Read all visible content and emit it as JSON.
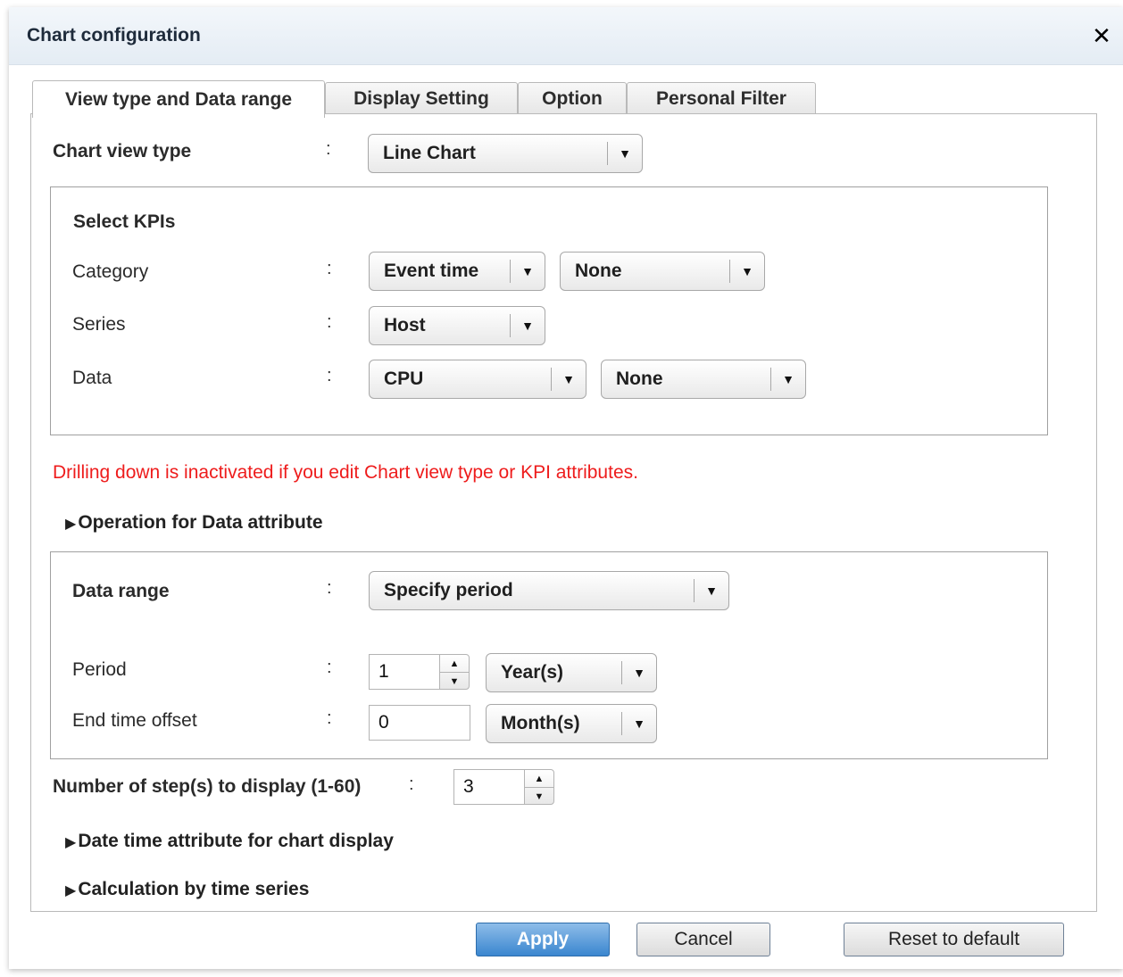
{
  "dialog": {
    "title": "Chart configuration",
    "close_glyph": "✕"
  },
  "tabs": [
    {
      "label": "View type and Data range",
      "active": true
    },
    {
      "label": "Display Setting",
      "active": false
    },
    {
      "label": "Option",
      "active": false
    },
    {
      "label": "Personal Filter",
      "active": false
    }
  ],
  "chart_view_type": {
    "label": "Chart view type",
    "value": "Line Chart"
  },
  "kpis": {
    "title": "Select KPIs",
    "category": {
      "label": "Category",
      "value1": "Event time",
      "value2": "None"
    },
    "series": {
      "label": "Series",
      "value": "Host"
    },
    "data": {
      "label": "Data",
      "value1": "CPU",
      "value2": "None"
    }
  },
  "warning": "Drilling down is inactivated if you edit Chart view type or KPI attributes.",
  "expanders": {
    "operation": "Operation for Data attribute",
    "datetime": "Date time attribute for chart display",
    "calculation": "Calculation by time series"
  },
  "data_range": {
    "label": "Data range",
    "value": "Specify period",
    "period": {
      "label": "Period",
      "value": "1",
      "unit": "Year(s)"
    },
    "end_offset": {
      "label": "End time offset",
      "value": "0",
      "unit": "Month(s)"
    }
  },
  "steps": {
    "label": "Number of step(s) to display (1-60)",
    "value": "3"
  },
  "buttons": {
    "apply": "Apply",
    "cancel": "Cancel",
    "reset": "Reset to default"
  },
  "colon": ":",
  "colors": {
    "warning": "#ee1c1c",
    "primary_button": "#3a86cf"
  },
  "icons": {
    "dropdown": "▼",
    "triangle": "▶",
    "spin_up": "▲",
    "spin_down": "▼"
  }
}
